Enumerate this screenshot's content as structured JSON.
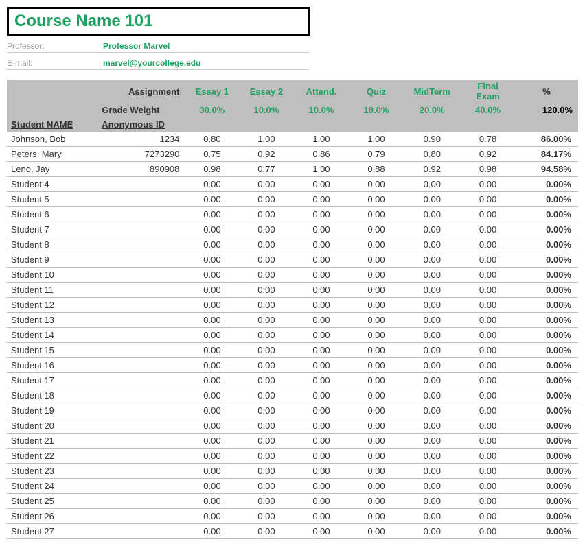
{
  "title": "Course Name 101",
  "professor_label": "Professor:",
  "professor_value": "Professor Marvel",
  "email_label": "E-mail:",
  "email_value": "marvel@yourcollege.edu",
  "headers": {
    "assignment": "Assignment",
    "grade_weight": "Grade Weight",
    "student_name": "Student NAME",
    "anonymous_id": "Anonymous ID",
    "pct": "%"
  },
  "assignments": [
    "Essay 1",
    "Essay 2",
    "Attend.",
    "Quiz",
    "MidTerm",
    "Final Exam"
  ],
  "weights": [
    "30.0%",
    "10.0%",
    "10.0%",
    "10.0%",
    "20.0%",
    "40.0%"
  ],
  "total_weight": "120.0%",
  "students": [
    {
      "name": "Johnson, Bob",
      "id": "1234",
      "scores": [
        "0.80",
        "1.00",
        "1.00",
        "1.00",
        "0.90",
        "0.78"
      ],
      "pct": "86.00%"
    },
    {
      "name": "Peters, Mary",
      "id": "7273290",
      "scores": [
        "0.75",
        "0.92",
        "0.86",
        "0.79",
        "0.80",
        "0.92"
      ],
      "pct": "84.17%"
    },
    {
      "name": "Leno, Jay",
      "id": "890908",
      "scores": [
        "0.98",
        "0.77",
        "1.00",
        "0.88",
        "0.92",
        "0.98"
      ],
      "pct": "94.58%"
    },
    {
      "name": "Student 4",
      "id": "",
      "scores": [
        "0.00",
        "0.00",
        "0.00",
        "0.00",
        "0.00",
        "0.00"
      ],
      "pct": "0.00%"
    },
    {
      "name": "Student 5",
      "id": "",
      "scores": [
        "0.00",
        "0.00",
        "0.00",
        "0.00",
        "0.00",
        "0.00"
      ],
      "pct": "0.00%"
    },
    {
      "name": "Student 6",
      "id": "",
      "scores": [
        "0.00",
        "0.00",
        "0.00",
        "0.00",
        "0.00",
        "0.00"
      ],
      "pct": "0.00%"
    },
    {
      "name": "Student 7",
      "id": "",
      "scores": [
        "0.00",
        "0.00",
        "0.00",
        "0.00",
        "0.00",
        "0.00"
      ],
      "pct": "0.00%"
    },
    {
      "name": "Student 8",
      "id": "",
      "scores": [
        "0.00",
        "0.00",
        "0.00",
        "0.00",
        "0.00",
        "0.00"
      ],
      "pct": "0.00%"
    },
    {
      "name": "Student 9",
      "id": "",
      "scores": [
        "0.00",
        "0.00",
        "0.00",
        "0.00",
        "0.00",
        "0.00"
      ],
      "pct": "0.00%"
    },
    {
      "name": "Student 10",
      "id": "",
      "scores": [
        "0.00",
        "0.00",
        "0.00",
        "0.00",
        "0.00",
        "0.00"
      ],
      "pct": "0.00%"
    },
    {
      "name": "Student 11",
      "id": "",
      "scores": [
        "0.00",
        "0.00",
        "0.00",
        "0.00",
        "0.00",
        "0.00"
      ],
      "pct": "0.00%"
    },
    {
      "name": "Student 12",
      "id": "",
      "scores": [
        "0.00",
        "0.00",
        "0.00",
        "0.00",
        "0.00",
        "0.00"
      ],
      "pct": "0.00%"
    },
    {
      "name": "Student 13",
      "id": "",
      "scores": [
        "0.00",
        "0.00",
        "0.00",
        "0.00",
        "0.00",
        "0.00"
      ],
      "pct": "0.00%"
    },
    {
      "name": "Student 14",
      "id": "",
      "scores": [
        "0.00",
        "0.00",
        "0.00",
        "0.00",
        "0.00",
        "0.00"
      ],
      "pct": "0.00%"
    },
    {
      "name": "Student 15",
      "id": "",
      "scores": [
        "0.00",
        "0.00",
        "0.00",
        "0.00",
        "0.00",
        "0.00"
      ],
      "pct": "0.00%"
    },
    {
      "name": "Student 16",
      "id": "",
      "scores": [
        "0.00",
        "0.00",
        "0.00",
        "0.00",
        "0.00",
        "0.00"
      ],
      "pct": "0.00%"
    },
    {
      "name": "Student 17",
      "id": "",
      "scores": [
        "0.00",
        "0.00",
        "0.00",
        "0.00",
        "0.00",
        "0.00"
      ],
      "pct": "0.00%"
    },
    {
      "name": "Student 18",
      "id": "",
      "scores": [
        "0.00",
        "0.00",
        "0.00",
        "0.00",
        "0.00",
        "0.00"
      ],
      "pct": "0.00%"
    },
    {
      "name": "Student 19",
      "id": "",
      "scores": [
        "0.00",
        "0.00",
        "0.00",
        "0.00",
        "0.00",
        "0.00"
      ],
      "pct": "0.00%"
    },
    {
      "name": "Student 20",
      "id": "",
      "scores": [
        "0.00",
        "0.00",
        "0.00",
        "0.00",
        "0.00",
        "0.00"
      ],
      "pct": "0.00%"
    },
    {
      "name": "Student 21",
      "id": "",
      "scores": [
        "0.00",
        "0.00",
        "0.00",
        "0.00",
        "0.00",
        "0.00"
      ],
      "pct": "0.00%"
    },
    {
      "name": "Student 22",
      "id": "",
      "scores": [
        "0.00",
        "0.00",
        "0.00",
        "0.00",
        "0.00",
        "0.00"
      ],
      "pct": "0.00%"
    },
    {
      "name": "Student 23",
      "id": "",
      "scores": [
        "0.00",
        "0.00",
        "0.00",
        "0.00",
        "0.00",
        "0.00"
      ],
      "pct": "0.00%"
    },
    {
      "name": "Student 24",
      "id": "",
      "scores": [
        "0.00",
        "0.00",
        "0.00",
        "0.00",
        "0.00",
        "0.00"
      ],
      "pct": "0.00%"
    },
    {
      "name": "Student 25",
      "id": "",
      "scores": [
        "0.00",
        "0.00",
        "0.00",
        "0.00",
        "0.00",
        "0.00"
      ],
      "pct": "0.00%"
    },
    {
      "name": "Student 26",
      "id": "",
      "scores": [
        "0.00",
        "0.00",
        "0.00",
        "0.00",
        "0.00",
        "0.00"
      ],
      "pct": "0.00%"
    },
    {
      "name": "Student 27",
      "id": "",
      "scores": [
        "0.00",
        "0.00",
        "0.00",
        "0.00",
        "0.00",
        "0.00"
      ],
      "pct": "0.00%"
    }
  ]
}
